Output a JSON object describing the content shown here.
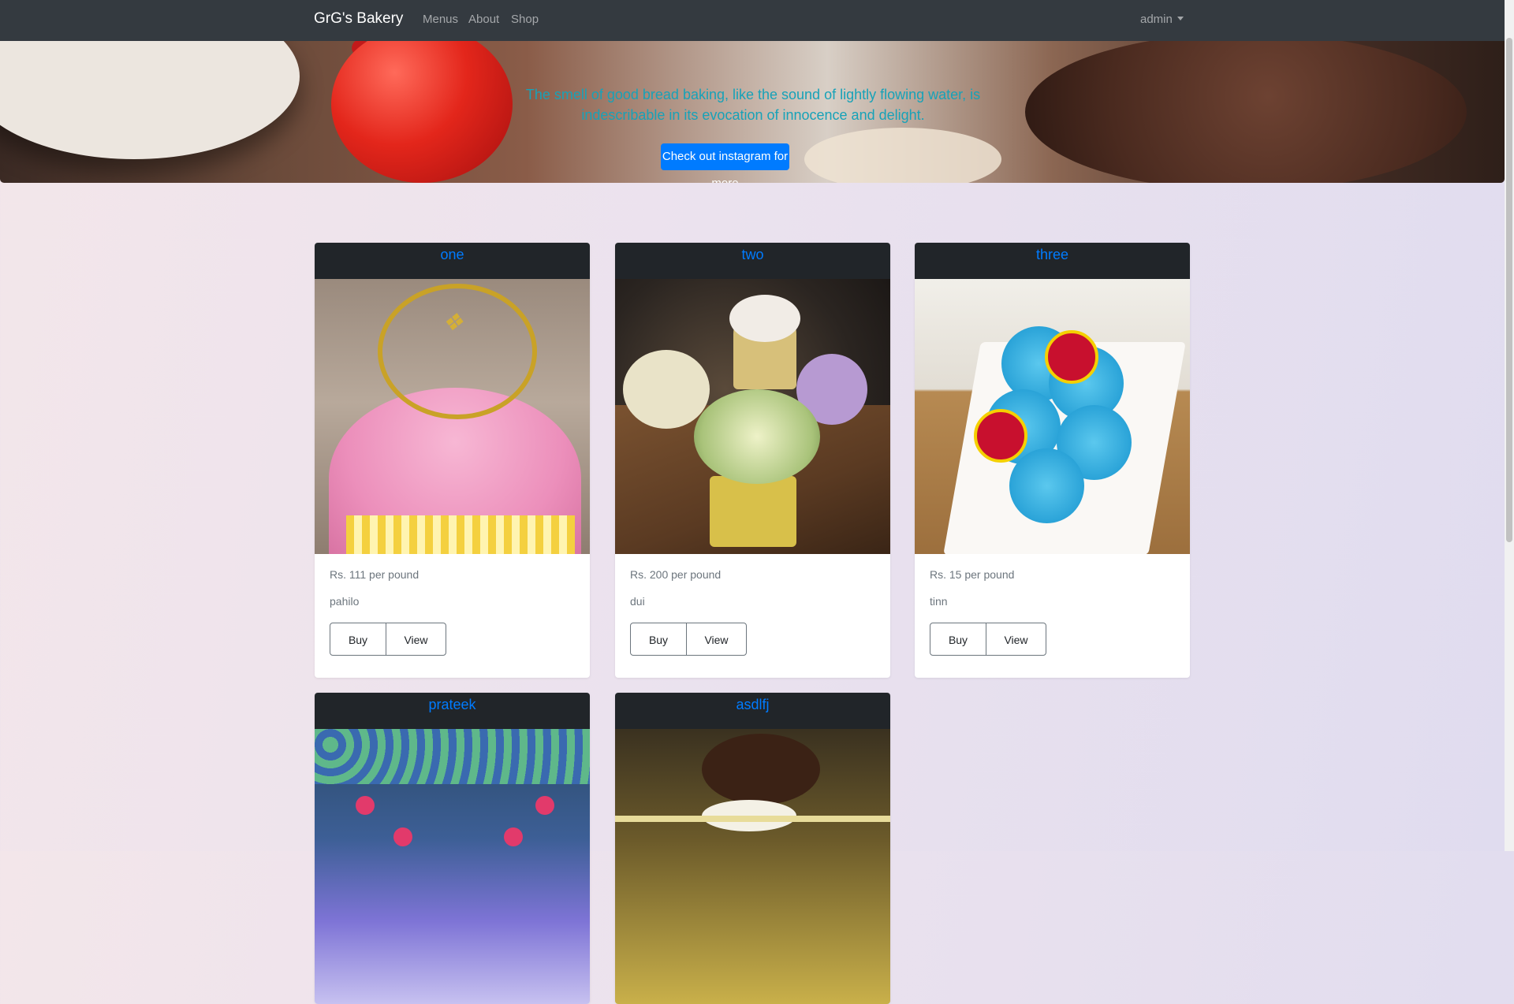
{
  "navbar": {
    "brand": "GrG's Bakery",
    "links": [
      {
        "label": "Menus"
      },
      {
        "label": "About"
      },
      {
        "label": "Shop"
      }
    ],
    "user_menu": {
      "label": "admin"
    }
  },
  "hero": {
    "quote": "The smell of good bread baking, like the sound of lightly flowing water, is indescribable in its evocation of innocence and delight.",
    "button_label": "Check out instagram for more"
  },
  "products": [
    {
      "name": "one",
      "price": "Rs. 111 per pound",
      "desc": "pahilo",
      "buy_label": "Buy",
      "view_label": "View"
    },
    {
      "name": "two",
      "price": "Rs. 200 per pound",
      "desc": "dui",
      "buy_label": "Buy",
      "view_label": "View"
    },
    {
      "name": "three",
      "price": "Rs. 15 per pound",
      "desc": "tinn",
      "buy_label": "Buy",
      "view_label": "View"
    },
    {
      "name": "prateek"
    },
    {
      "name": "asdlfj"
    }
  ],
  "colors": {
    "navbar_bg": "#343a40",
    "accent_blue": "#007bff",
    "quote_teal": "#17a2b8",
    "card_header_bg": "#212529"
  }
}
